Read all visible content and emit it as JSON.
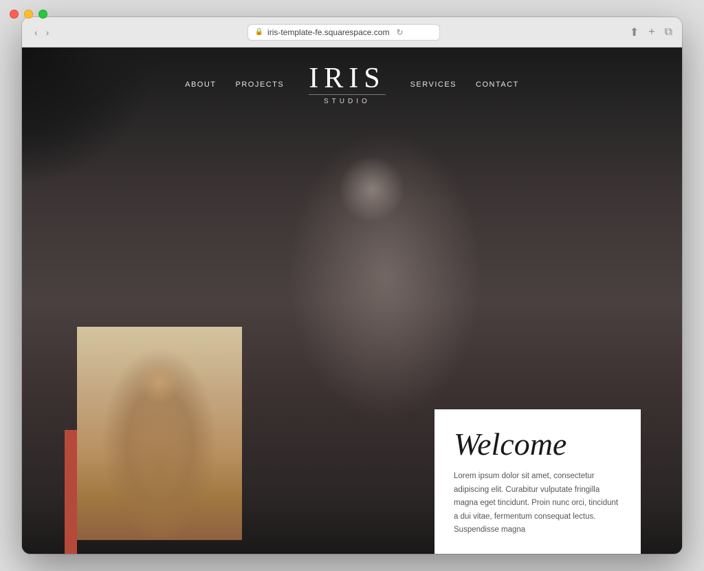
{
  "browser": {
    "url": "iris-template-fe.squarespace.com",
    "traffic_lights": {
      "close": "close",
      "minimize": "minimize",
      "maximize": "maximize"
    }
  },
  "nav": {
    "about": "About",
    "projects": "Projects",
    "services": "Services",
    "contact": "Contact",
    "logo_main": "IRIS",
    "logo_sub": "STUDIO"
  },
  "welcome": {
    "title": "Welcome",
    "body": "Lorem ipsum dolor sit amet, consectetur adipiscing elit. Curabitur vulputate fringilla magna eget tincidunt. Proin nunc orci, tincidunt a dui vitae, fermentum consequat lectus. Suspendisse magna"
  }
}
